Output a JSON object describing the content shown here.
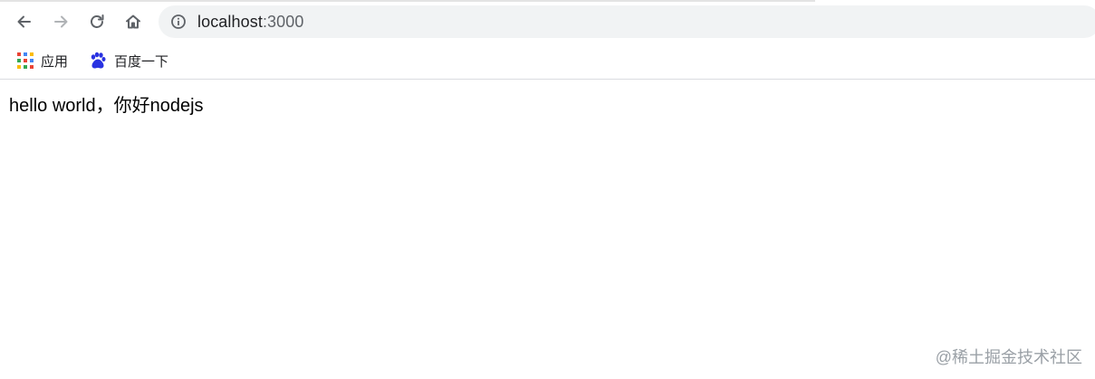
{
  "browser": {
    "url": {
      "host": "localhost",
      "port": ":3000"
    },
    "icons": {
      "back": "arrow-left",
      "forward": "arrow-right",
      "reload": "reload",
      "home": "home",
      "site_info": "info-circle"
    }
  },
  "bookmarks": [
    {
      "label": "应用",
      "icon": "apps-grid"
    },
    {
      "label": "百度一下",
      "icon": "baidu-paw"
    }
  ],
  "page": {
    "text": "hello world，你好nodejs"
  },
  "watermark": "@稀土掘金技术社区",
  "colors": {
    "icon_gray": "#5f6368",
    "disabled_gray": "#b0b3b6",
    "omnibox_bg": "#f1f3f4",
    "baidu_blue": "#2932e1"
  }
}
